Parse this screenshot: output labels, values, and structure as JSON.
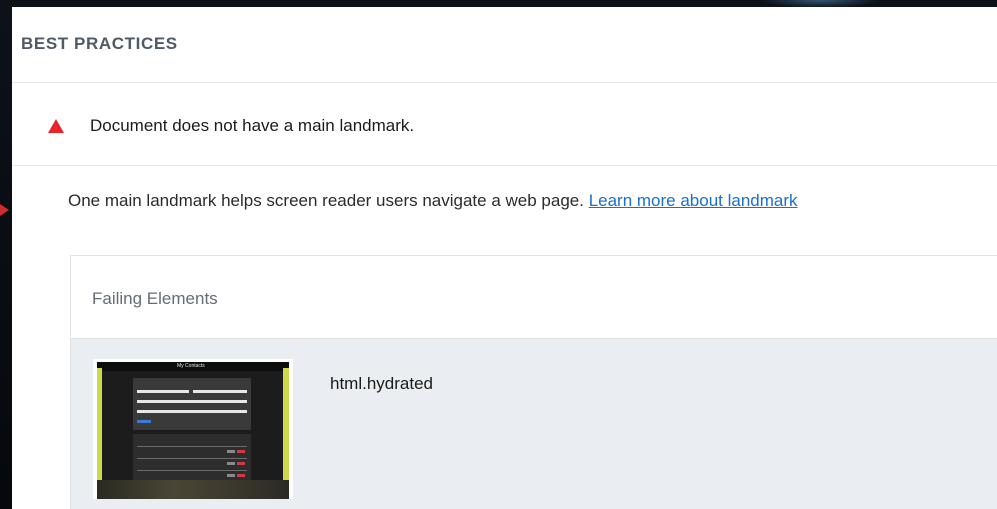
{
  "section": {
    "title": "BEST PRACTICES"
  },
  "issue": {
    "icon": "warning-triangle-icon",
    "severity_color": "#e8262a",
    "title": "Document does not have a main landmark."
  },
  "description": {
    "text": "One main landmark helps screen reader users navigate a web page. ",
    "link_text": "Learn more about landmark"
  },
  "failing_elements": {
    "title": "Failing Elements",
    "items": [
      {
        "selector": "html.hydrated",
        "thumbnail_caption": "My Contacts"
      }
    ]
  },
  "colors": {
    "link": "#1a6fd0",
    "row_background": "#eaedf1"
  }
}
